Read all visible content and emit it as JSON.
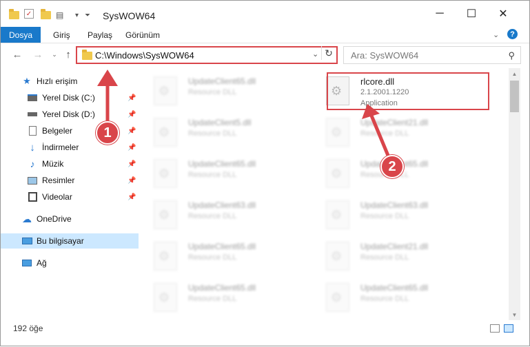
{
  "window": {
    "title": "SysWOW64",
    "controls": {
      "minimize": "─",
      "maximize": "☐",
      "close": "✕"
    }
  },
  "ribbon": {
    "tabs": [
      {
        "label": "Dosya",
        "active": true
      },
      {
        "label": "Giriş"
      },
      {
        "label": "Paylaş"
      },
      {
        "label": "Görünüm"
      }
    ],
    "expand_icon": "chevron-down-icon",
    "help_icon": "help-icon"
  },
  "address": {
    "path": "C:\\Windows\\SysWOW64",
    "search_placeholder": "Ara: SysWOW64"
  },
  "nav": {
    "quick_access": "Hızlı erişim",
    "items": [
      {
        "label": "Yerel Disk (C:)",
        "icon": "drive-icon",
        "pinned": true
      },
      {
        "label": "Yerel Disk (D:)",
        "icon": "drive-icon",
        "pinned": true
      },
      {
        "label": "Belgeler",
        "icon": "documents-icon",
        "pinned": true
      },
      {
        "label": "İndirmeler",
        "icon": "downloads-icon",
        "pinned": true
      },
      {
        "label": "Müzik",
        "icon": "music-icon",
        "pinned": true
      },
      {
        "label": "Resimler",
        "icon": "pictures-icon",
        "pinned": true
      },
      {
        "label": "Videolar",
        "icon": "videos-icon",
        "pinned": true
      }
    ],
    "onedrive": "OneDrive",
    "this_pc": "Bu bilgisayar",
    "network": "Ağ"
  },
  "files": {
    "left": [
      {
        "name": "UpdateClient65.dll",
        "desc": "Resource DLL"
      },
      {
        "name": "UpdateClient5.dll",
        "desc": "Resource DLL"
      },
      {
        "name": "UpdateClient65.dll",
        "desc": "Resource DLL"
      },
      {
        "name": "UpdateClient63.dll",
        "desc": "Resource DLL"
      },
      {
        "name": "UpdateClient65.dll",
        "desc": "Resource DLL"
      },
      {
        "name": "UpdateClient65.dll",
        "desc": "Resource DLL"
      }
    ],
    "right": [
      {
        "name": "rlcore.dll",
        "desc": "2.1.2001.1220",
        "desc2": "Application"
      },
      {
        "name": "UpdateClient21.dll",
        "desc": "Resource DLL"
      },
      {
        "name": "UpdateClient65.dll",
        "desc": "Resource DLL"
      },
      {
        "name": "UpdateClient63.dll",
        "desc": "Resource DLL"
      },
      {
        "name": "UpdateClient21.dll",
        "desc": "Resource DLL"
      },
      {
        "name": "UpdateClient65.dll",
        "desc": "Resource DLL"
      }
    ]
  },
  "status": {
    "count": "192 öğe"
  },
  "annotations": {
    "callout_1": "1",
    "callout_2": "2",
    "color": "#d9454a"
  }
}
